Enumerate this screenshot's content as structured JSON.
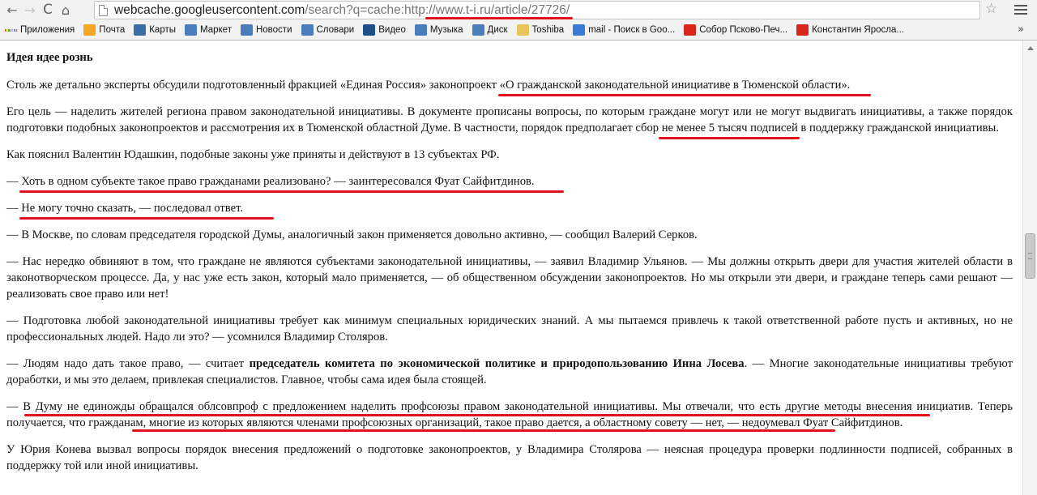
{
  "browser": {
    "url_host": "webcache.googleusercontent.com",
    "url_path": "/search?q=cache:http:",
    "url_highlight": "//www.t-i.ru/article/27726/",
    "back_icon": "←",
    "forward_icon": "→",
    "reload_icon": "C",
    "home_icon": "⌂",
    "star_icon": "☆",
    "bookmarks": [
      {
        "label": "Приложения",
        "icon": "apps-icon",
        "color": "#4a89dc"
      },
      {
        "label": "Почта",
        "icon": "mail-ru-icon",
        "color": "#f5a623"
      },
      {
        "label": "Карты",
        "icon": "maps-icon",
        "color": "#3b6ea5"
      },
      {
        "label": "Маркет",
        "icon": "market-icon",
        "color": "#4a7ebb"
      },
      {
        "label": "Новости",
        "icon": "news-icon",
        "color": "#4a7ebb"
      },
      {
        "label": "Словари",
        "icon": "dictionary-icon",
        "color": "#4a7ebb"
      },
      {
        "label": "Видео",
        "icon": "video-icon",
        "color": "#1f4f8a"
      },
      {
        "label": "Музыка",
        "icon": "music-icon",
        "color": "#4a7ebb"
      },
      {
        "label": "Диск",
        "icon": "disk-icon",
        "color": "#4a7ebb"
      },
      {
        "label": "Toshiba",
        "icon": "folder-icon",
        "color": "#e8c55a"
      },
      {
        "label": "mail - Поиск в Goo...",
        "icon": "google-icon",
        "color": "#3a7bd5"
      },
      {
        "label": "Собор Псково-Печ...",
        "icon": "yandex-icon",
        "color": "#d9261c"
      },
      {
        "label": "Константин Яросла...",
        "icon": "yandex-icon",
        "color": "#d9261c"
      }
    ],
    "bookmarks_more": "»"
  },
  "article": {
    "heading": "Идея идее рознь",
    "p1_before": "Столь же детально эксперты обсудили подготовленный фракцией «Единая Россия» законопроект ",
    "p1_ul": "«О гражданской законодательной инициативе в Тюменской области».",
    "p2_before": "Его цель — наделить жителей региона правом законодательной инициативы. В документе прописаны вопросы, по которым граждане могут или не могут выдвигать инициативы, а также порядок подготовки подобных законопроектов и рассмотрения их в Тюменской областной Думе. В частности, порядок предполагает сбор ",
    "p2_ul": "не менее 5 тысяч подписей",
    "p2_after": " в поддержку гражданской инициативы.",
    "p3": "Как пояснил Валентин Юдашкин, подобные законы уже приняты и действуют в 13 субъектах РФ.",
    "p4_before": "— ",
    "p4_ul": "Хоть в одном субъекте такое право гражданами реализовано? — заинтересовался Фуат Сайфитдинов.",
    "p5_before": "— ",
    "p5_ul": "Не могу точно сказать, — последовал ответ.",
    "p6": "— В Москве, по словам председателя городской Думы, аналогичный закон применяется довольно активно, — сообщил Валерий Серков.",
    "p7": "— Нас нередко обвиняют в том, что граждане не являются субъектами законодательной инициативы, — заявил Владимир Ульянов. — Мы должны открыть двери для участия жителей области в законотворческом процессе. Да, у нас уже есть закон, который мало применяется, — об общественном обсуждении законопроектов. Но мы открыли эти двери, и граждане теперь сами решают — реализовать свое право или нет!",
    "p8": "— Подготовка любой законодательной инициативы требует как минимум специальных юридических знаний. А мы пытаемся привлечь к такой ответственной работе пусть и активных, но не профессиональных людей. Надо ли это? — усомнился Владимир Столяров.",
    "p9_before": "— Людям надо дать такое право, — считает ",
    "p9_bold": "председатель комитета по экономической политике и природопользованию Инна Лосева",
    "p9_after": ". — Многие законодательные инициативы требуют доработки, и мы это делаем, привлекая специалистов. Главное, чтобы сама идея была стоящей.",
    "p10": "— В Думу не единожды обращался облсовпроф с предложением наделить профсоюзы правом законодательной инициативы. Мы отвечали, что есть другие методы внесения инициатив. Теперь получается, что гражданам, многие из которых являются членами профсоюзных организаций, такое право дается, а областному совету — нет, — недоумевал Фуат Сайфитдинов.",
    "p11": "У Юрия Конева вызвал вопросы порядок внесения предложений о подготовке законопроектов, у Владимира Столярова — неясная процедура проверки подлинности подписей, собранных в поддержку той или иной инициативы."
  },
  "colors": {
    "underline": "#e1121a",
    "chrome_bg": "#f2f2f2"
  }
}
